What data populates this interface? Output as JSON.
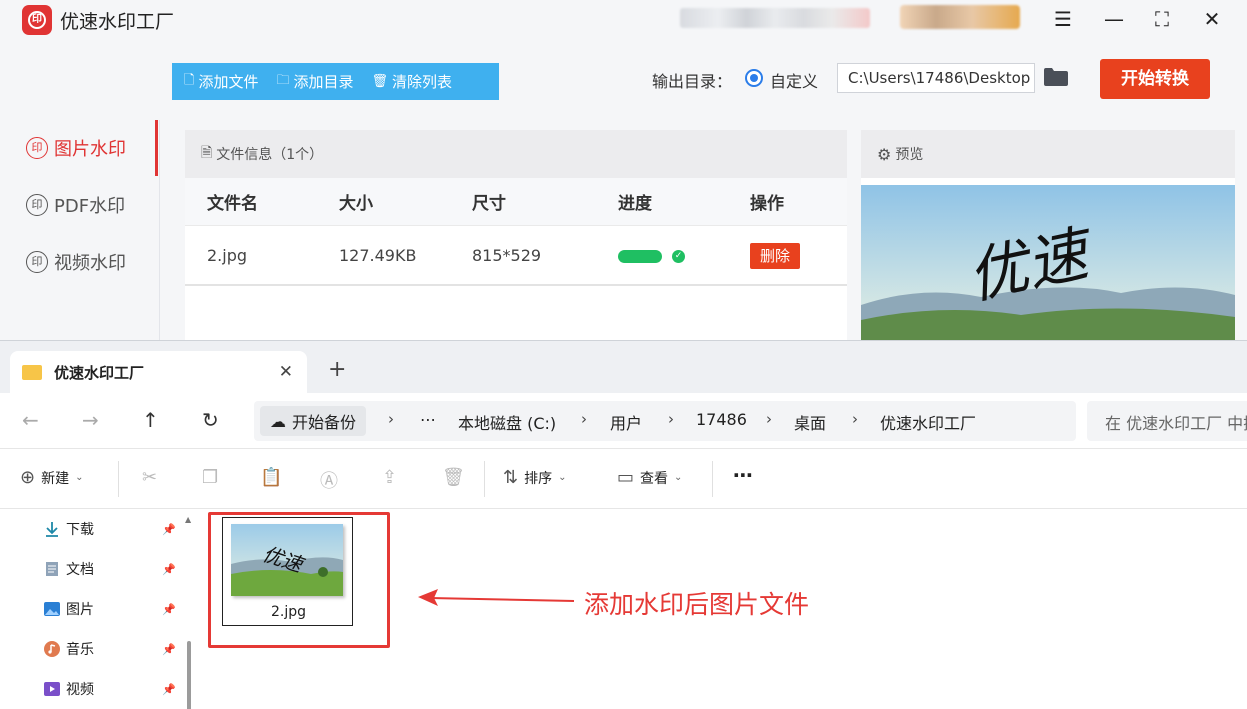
{
  "app": {
    "title": "优速水印工厂",
    "toolbar": {
      "add_file": "添加文件",
      "add_dir": "添加目录",
      "clear_list": "清除列表"
    },
    "output": {
      "label": "输出目录：",
      "option": "自定义",
      "path": "C:\\Users\\17486\\Desktop",
      "start_button": "开始转换"
    },
    "sidebar": [
      {
        "label": "图片水印",
        "active": true
      },
      {
        "label": "PDF水印",
        "active": false
      },
      {
        "label": "视频水印",
        "active": false
      }
    ],
    "file_panel": {
      "header": "文件信息（1个）",
      "columns": [
        "文件名",
        "大小",
        "尺寸",
        "进度",
        "操作"
      ],
      "rows": [
        {
          "name": "2.jpg",
          "size": "127.49KB",
          "dims": "815*529",
          "progress": 1.0,
          "action": "删除"
        }
      ]
    },
    "preview": {
      "header": "预览",
      "watermark_text": "优速"
    }
  },
  "explorer": {
    "tab_title": "优速水印工厂",
    "address": {
      "home": "开始备份",
      "crumbs": [
        "本地磁盘 (C:)",
        "用户",
        "17486",
        "桌面",
        "优速水印工厂"
      ]
    },
    "search_placeholder": "在 优速水印工厂 中搜索",
    "commands": {
      "new": "新建",
      "sort": "排序",
      "view": "查看"
    },
    "nav_items": [
      {
        "label": "下载",
        "icon": "download-icon"
      },
      {
        "label": "文档",
        "icon": "document-icon"
      },
      {
        "label": "图片",
        "icon": "pictures-icon"
      },
      {
        "label": "音乐",
        "icon": "music-icon"
      },
      {
        "label": "视频",
        "icon": "video-icon"
      }
    ],
    "file": {
      "name": "2.jpg"
    },
    "annotation": "添加水印后图片文件"
  },
  "colors": {
    "accent_red": "#e8411e",
    "toolbar_blue": "#3fb0ef",
    "progress_green": "#1fbf62",
    "annotation_red": "#e53935"
  }
}
